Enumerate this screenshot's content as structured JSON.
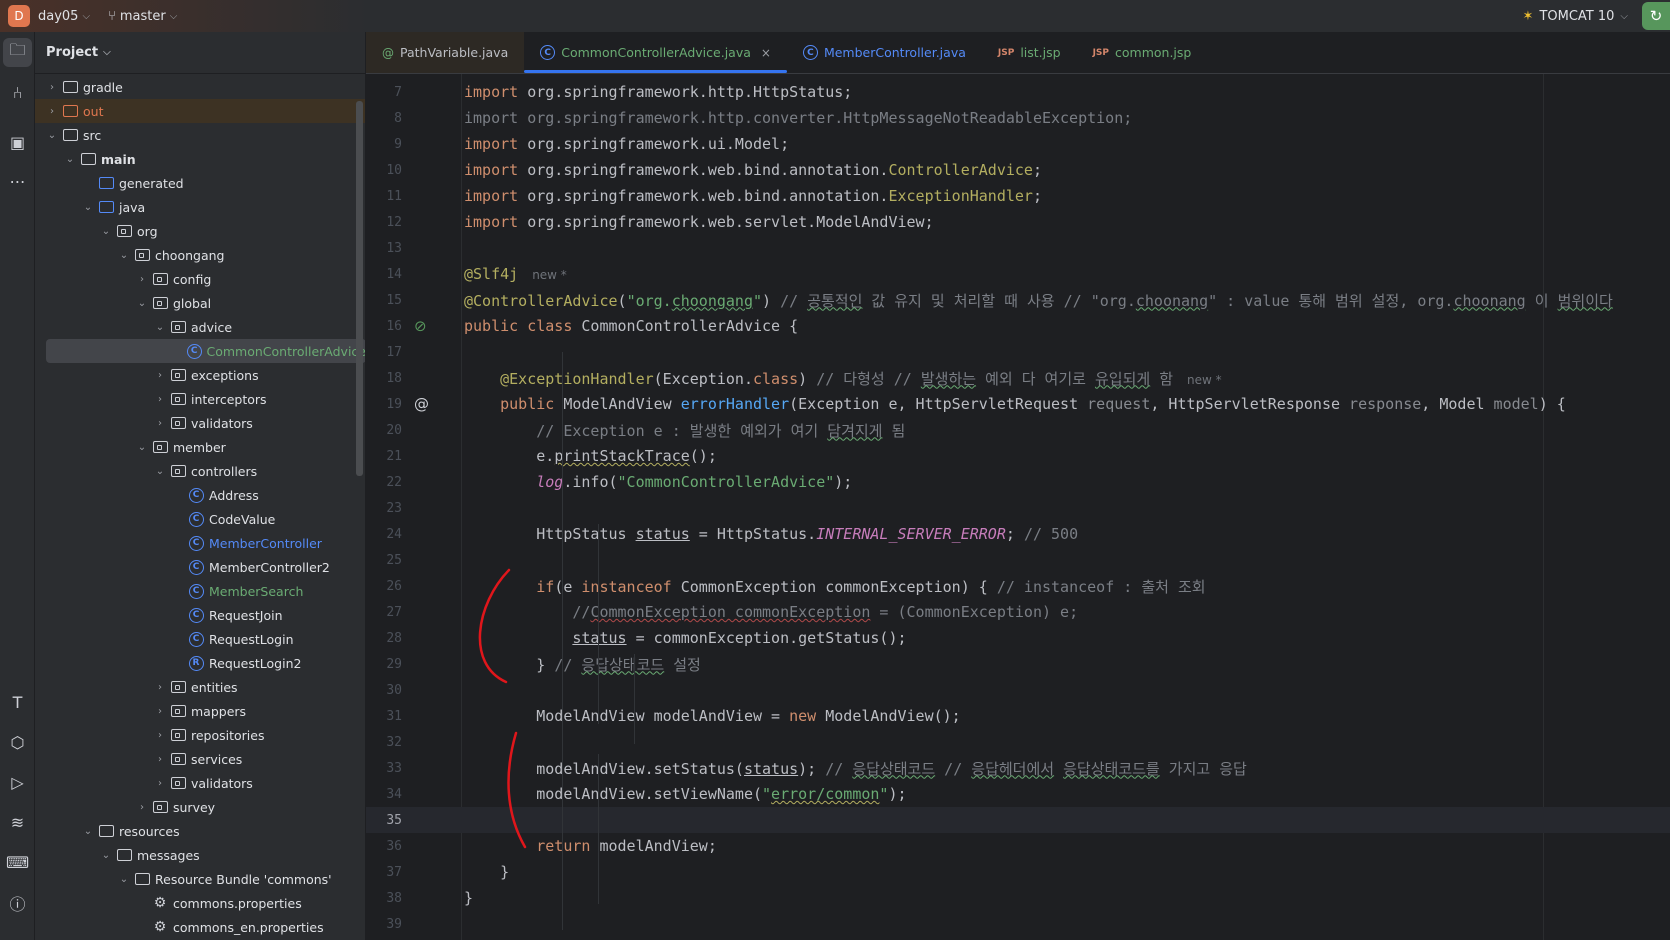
{
  "titlebar": {
    "project_initial": "D",
    "project": "day05",
    "branch": "master",
    "run_config": "TOMCAT 10"
  },
  "colors": {
    "accent": "#3574f0",
    "run": "#57965c",
    "project_badge": "#e0774f",
    "annotation_ink": "#e0161b"
  },
  "project_panel": {
    "title": "Project",
    "tree": [
      {
        "label": "gradle",
        "depth": 0,
        "arrow": "right",
        "icon": "folder-icon"
      },
      {
        "label": "out",
        "depth": 0,
        "arrow": "right",
        "icon": "excluded-folder-icon",
        "variant": "out"
      },
      {
        "label": "src",
        "depth": 0,
        "arrow": "down",
        "icon": "folder-icon"
      },
      {
        "label": "main",
        "depth": 1,
        "arrow": "down",
        "icon": "module-folder-icon",
        "bold": true
      },
      {
        "label": "generated",
        "depth": 2,
        "arrow": "",
        "icon": "generated-folder-icon"
      },
      {
        "label": "java",
        "depth": 2,
        "arrow": "down",
        "icon": "source-folder-icon"
      },
      {
        "label": "org",
        "depth": 3,
        "arrow": "down",
        "icon": "package-icon"
      },
      {
        "label": "choongang",
        "depth": 4,
        "arrow": "down",
        "icon": "package-icon"
      },
      {
        "label": "config",
        "depth": 5,
        "arrow": "right",
        "icon": "package-icon"
      },
      {
        "label": "global",
        "depth": 5,
        "arrow": "down",
        "icon": "package-icon"
      },
      {
        "label": "advice",
        "depth": 6,
        "arrow": "down",
        "icon": "package-icon"
      },
      {
        "label": "CommonControllerAdvice",
        "depth": 7,
        "arrow": "",
        "icon": "class-icon",
        "color": "#6aab73",
        "selected": true
      },
      {
        "label": "exceptions",
        "depth": 6,
        "arrow": "right",
        "icon": "package-icon"
      },
      {
        "label": "interceptors",
        "depth": 6,
        "arrow": "right",
        "icon": "package-icon"
      },
      {
        "label": "validators",
        "depth": 6,
        "arrow": "right",
        "icon": "package-icon"
      },
      {
        "label": "member",
        "depth": 5,
        "arrow": "down",
        "icon": "package-icon"
      },
      {
        "label": "controllers",
        "depth": 6,
        "arrow": "down",
        "icon": "package-icon"
      },
      {
        "label": "Address",
        "depth": 7,
        "arrow": "",
        "icon": "class-icon"
      },
      {
        "label": "CodeValue",
        "depth": 7,
        "arrow": "",
        "icon": "class-icon"
      },
      {
        "label": "MemberController",
        "depth": 7,
        "arrow": "",
        "icon": "class-icon",
        "color": "#548af7"
      },
      {
        "label": "MemberController2",
        "depth": 7,
        "arrow": "",
        "icon": "class-icon"
      },
      {
        "label": "MemberSearch",
        "depth": 7,
        "arrow": "",
        "icon": "class-icon",
        "color": "#6aab73"
      },
      {
        "label": "RequestJoin",
        "depth": 7,
        "arrow": "",
        "icon": "class-icon"
      },
      {
        "label": "RequestLogin",
        "depth": 7,
        "arrow": "",
        "icon": "class-icon"
      },
      {
        "label": "RequestLogin2",
        "depth": 7,
        "arrow": "",
        "icon": "record-icon"
      },
      {
        "label": "entities",
        "depth": 6,
        "arrow": "right",
        "icon": "package-icon"
      },
      {
        "label": "mappers",
        "depth": 6,
        "arrow": "right",
        "icon": "package-icon"
      },
      {
        "label": "repositories",
        "depth": 6,
        "arrow": "right",
        "icon": "package-icon"
      },
      {
        "label": "services",
        "depth": 6,
        "arrow": "right",
        "icon": "package-icon"
      },
      {
        "label": "validators",
        "depth": 6,
        "arrow": "right",
        "icon": "package-icon"
      },
      {
        "label": "survey",
        "depth": 5,
        "arrow": "right",
        "icon": "package-icon"
      },
      {
        "label": "resources",
        "depth": 2,
        "arrow": "down",
        "icon": "resources-folder-icon"
      },
      {
        "label": "messages",
        "depth": 3,
        "arrow": "down",
        "icon": "folder-icon"
      },
      {
        "label": "Resource Bundle 'commons'",
        "depth": 4,
        "arrow": "down",
        "icon": "resource-bundle-icon"
      },
      {
        "label": "commons.properties",
        "depth": 5,
        "arrow": "",
        "icon": "properties-icon"
      },
      {
        "label": "commons_en.properties",
        "depth": 5,
        "arrow": "",
        "icon": "properties-icon"
      }
    ]
  },
  "tabs": [
    {
      "label": "PathVariable.java",
      "icon": "annotation-icon",
      "color": "#bcbec4",
      "glyph": "@",
      "iconColor": "#6aab73"
    },
    {
      "label": "CommonControllerAdvice.java",
      "icon": "class-icon",
      "color": "#6aab73",
      "active": true,
      "closable": true,
      "close": "×"
    },
    {
      "label": "MemberController.java",
      "icon": "class-icon",
      "color": "#548af7"
    },
    {
      "label": "list.jsp",
      "icon": "jsp-icon",
      "color": "#6aab73",
      "glyph": "JSP"
    },
    {
      "label": "common.jsp",
      "icon": "jsp-icon",
      "color": "#6aab73",
      "glyph": "JSP"
    }
  ],
  "editor": {
    "current_line": 35,
    "lines": [
      {
        "n": 7,
        "t": [
          [
            "kw",
            "import "
          ],
          [
            "",
            "org.springframework.http.HttpStatus;"
          ]
        ]
      },
      {
        "n": 8,
        "t": [
          [
            "cm",
            "import org.springframework.http.converter.HttpMessageNotReadableException;"
          ]
        ]
      },
      {
        "n": 9,
        "t": [
          [
            "kw",
            "import "
          ],
          [
            "",
            "org.springframework.ui.Model;"
          ]
        ]
      },
      {
        "n": 10,
        "t": [
          [
            "kw",
            "import "
          ],
          [
            "",
            "org.springframework.web.bind.annotation."
          ],
          [
            "ann",
            "ControllerAdvice"
          ],
          [
            "",
            ";"
          ]
        ]
      },
      {
        "n": 11,
        "t": [
          [
            "kw",
            "import "
          ],
          [
            "",
            "org.springframework.web.bind.annotation."
          ],
          [
            "ann",
            "ExceptionHandler"
          ],
          [
            "",
            ";"
          ]
        ]
      },
      {
        "n": 12,
        "t": [
          [
            "kw",
            "import "
          ],
          [
            "",
            "org.springframework.web.servlet.ModelAndView;"
          ]
        ]
      },
      {
        "n": 13,
        "t": []
      },
      {
        "n": 14,
        "t": [
          [
            "ann",
            "@Slf4j"
          ]
        ],
        "hint": "new *"
      },
      {
        "n": 15,
        "t": [
          [
            "ann",
            "@ControllerAdvice"
          ],
          [
            "",
            "("
          ],
          [
            "str",
            "\"org."
          ],
          [
            "str wv",
            "choongang"
          ],
          [
            "str",
            "\""
          ],
          [
            "",
            ")"
          ],
          [
            "cm",
            " // "
          ],
          [
            "cm wv",
            "공통적인"
          ],
          [
            "cm",
            " 값 유지 및 처리할 때 사용 // \"org."
          ],
          [
            "cm wv",
            "choonang"
          ],
          [
            "cm",
            "\" : value 통해 범위 설정, org."
          ],
          [
            "cm wv",
            "choonang"
          ],
          [
            "cm",
            " 이 "
          ],
          [
            "cm wv",
            "범위이다"
          ]
        ]
      },
      {
        "n": 16,
        "t": [
          [
            "kw",
            "public class "
          ],
          [
            "",
            "CommonControllerAdvice {"
          ]
        ],
        "gutter": "bean-icon"
      },
      {
        "n": 17,
        "t": []
      },
      {
        "n": 18,
        "t": [
          [
            "",
            "    "
          ],
          [
            "ann",
            "@ExceptionHandler"
          ],
          [
            "",
            "(Exception."
          ],
          [
            "kw",
            "class"
          ],
          [
            "",
            ")"
          ],
          [
            "cm",
            " // 다형성 // "
          ],
          [
            "cm wv",
            "발생하는"
          ],
          [
            "cm",
            " 예외 다 여기로 "
          ],
          [
            "cm wv",
            "유입되게"
          ],
          [
            "cm",
            " 함"
          ]
        ],
        "hint": "new *"
      },
      {
        "n": 19,
        "t": [
          [
            "",
            "    "
          ],
          [
            "kw",
            "public "
          ],
          [
            "",
            "ModelAndView "
          ],
          [
            "fn",
            "errorHandler"
          ],
          [
            "",
            "(Exception e, HttpServletRequest "
          ],
          [
            "par",
            "request"
          ],
          [
            "",
            ", HttpServletResponse "
          ],
          [
            "par",
            "response"
          ],
          [
            "",
            ", Model "
          ],
          [
            "par",
            "model"
          ],
          [
            "",
            ") {"
          ]
        ],
        "gutter": "at-icon"
      },
      {
        "n": 20,
        "t": [
          [
            "cm",
            "        // Exception e : 발생한 예외가 여기 "
          ],
          [
            "cm wv",
            "담겨지게"
          ],
          [
            "cm",
            " 됨"
          ]
        ]
      },
      {
        "n": 21,
        "t": [
          [
            "",
            "        e."
          ],
          [
            "wvy",
            "printStackTrace"
          ],
          [
            "",
            "();"
          ]
        ]
      },
      {
        "n": 22,
        "t": [
          [
            "",
            "        "
          ],
          [
            "stat",
            "log"
          ],
          [
            "",
            ".info("
          ],
          [
            "str",
            "\"CommonControllerAdvice\""
          ],
          [
            "",
            ");"
          ]
        ]
      },
      {
        "n": 23,
        "t": []
      },
      {
        "n": 24,
        "t": [
          [
            "",
            "        HttpStatus "
          ],
          [
            "ul",
            "status"
          ],
          [
            "",
            " = HttpStatus."
          ],
          [
            "stat",
            "INTERNAL_SERVER_ERROR"
          ],
          [
            "",
            "; "
          ],
          [
            "cm",
            "// 500"
          ]
        ]
      },
      {
        "n": 25,
        "t": []
      },
      {
        "n": 26,
        "t": [
          [
            "",
            "        "
          ],
          [
            "kw",
            "if"
          ],
          [
            "",
            "(e "
          ],
          [
            "kw",
            "instanceof "
          ],
          [
            "",
            "CommonException commonException) { "
          ],
          [
            "cm",
            "// instanceof : 출처 조회"
          ]
        ]
      },
      {
        "n": 27,
        "t": [
          [
            "cm",
            "            //"
          ],
          [
            "cm wvr",
            "CommonException commonException"
          ],
          [
            "cm",
            " = (CommonException) e;"
          ]
        ]
      },
      {
        "n": 28,
        "t": [
          [
            "",
            "            "
          ],
          [
            "ul",
            "status"
          ],
          [
            "",
            " = commonException.getStatus();"
          ]
        ]
      },
      {
        "n": 29,
        "t": [
          [
            "",
            "        } "
          ],
          [
            "cm",
            "// "
          ],
          [
            "cm wv",
            "응답상태코드"
          ],
          [
            "cm",
            " 설정"
          ]
        ]
      },
      {
        "n": 30,
        "t": []
      },
      {
        "n": 31,
        "t": [
          [
            "",
            "        ModelAndView modelAndView = "
          ],
          [
            "kw",
            "new "
          ],
          [
            "",
            "ModelAndView();"
          ]
        ]
      },
      {
        "n": 32,
        "t": []
      },
      {
        "n": 33,
        "t": [
          [
            "",
            "        modelAndView.setStatus("
          ],
          [
            "ul",
            "status"
          ],
          [
            "",
            "); "
          ],
          [
            "cm",
            "// "
          ],
          [
            "cm wv",
            "응답상태코드"
          ],
          [
            "cm",
            " // "
          ],
          [
            "cm wv",
            "응답헤더에서"
          ],
          [
            "cm",
            " "
          ],
          [
            "cm wv",
            "응답상태코드를"
          ],
          [
            "cm",
            " 가지고 응답"
          ]
        ]
      },
      {
        "n": 34,
        "t": [
          [
            "",
            "        modelAndView.setViewName("
          ],
          [
            "str",
            "\""
          ],
          [
            "str wvy",
            "error/common"
          ],
          [
            "str",
            "\""
          ],
          [
            "",
            ");"
          ]
        ]
      },
      {
        "n": 35,
        "t": []
      },
      {
        "n": 36,
        "t": [
          [
            "",
            "        "
          ],
          [
            "kw",
            "return "
          ],
          [
            "",
            "modelAndView;"
          ]
        ]
      },
      {
        "n": 37,
        "t": [
          [
            "",
            "    }"
          ]
        ]
      },
      {
        "n": 38,
        "t": [
          [
            "",
            "}"
          ]
        ]
      },
      {
        "n": 39,
        "t": []
      }
    ]
  }
}
